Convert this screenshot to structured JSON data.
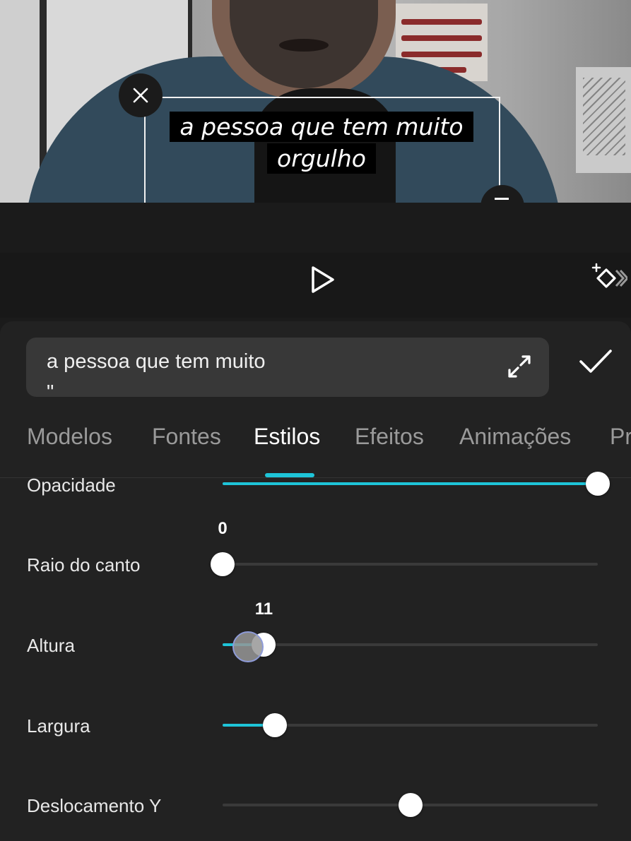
{
  "preview": {
    "caption_line1": "a pessoa que tem muito",
    "caption_line2": "orgulho"
  },
  "editor": {
    "text_value_line1": "a pessoa que tem muito",
    "text_value_line2": "\""
  },
  "tabs": [
    {
      "label": "Modelos",
      "active": false
    },
    {
      "label": "Fontes",
      "active": false
    },
    {
      "label": "Estilos",
      "active": true
    },
    {
      "label": "Efeitos",
      "active": false
    },
    {
      "label": "Animações",
      "active": false
    },
    {
      "label": "Pr",
      "active": false
    }
  ],
  "sliders": [
    {
      "label": "Opacidade",
      "value": 100,
      "value_text": ""
    },
    {
      "label": "Raio do canto",
      "value": 0,
      "value_text": "0"
    },
    {
      "label": "Altura",
      "value": 11,
      "value_text": "11"
    },
    {
      "label": "Largura",
      "value": 14,
      "value_text": ""
    },
    {
      "label": "Deslocamento Y",
      "value": 50,
      "value_text": ""
    }
  ],
  "colors": {
    "accent": "#1ec4d8",
    "panel_bg": "#222222",
    "input_bg": "#383838"
  },
  "icons": {
    "close": "close-icon",
    "play": "play-icon",
    "keyframe": "keyframe-icon",
    "expand": "expand-icon",
    "confirm": "check-icon"
  }
}
